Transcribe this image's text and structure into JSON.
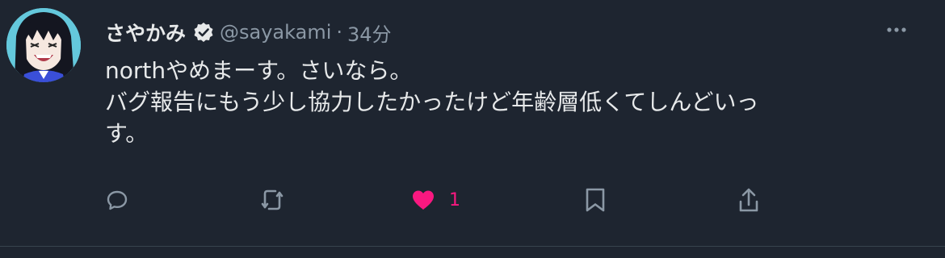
{
  "tweet": {
    "display_name": "さやかみ",
    "handle": "@sayakami",
    "separator": "·",
    "time": "34分",
    "text_lines": [
      "northやめまーす。さいなら。",
      "バグ報告にもう少し協力したかったけど年齢層低くてしんどいっ",
      "す。"
    ]
  },
  "actions": {
    "like_count": "1"
  },
  "icons": {
    "verified": "verified-badge-icon",
    "more": "more-dots-icon",
    "reply": "reply-icon",
    "retweet": "retweet-icon",
    "like": "heart-icon",
    "bookmark": "bookmark-icon",
    "share": "share-icon"
  },
  "colors": {
    "background": "#1e2530",
    "text": "#e7e9ea",
    "secondary": "#8b98a5",
    "like": "#f91880",
    "avatar_bg": "#64c8dc"
  }
}
